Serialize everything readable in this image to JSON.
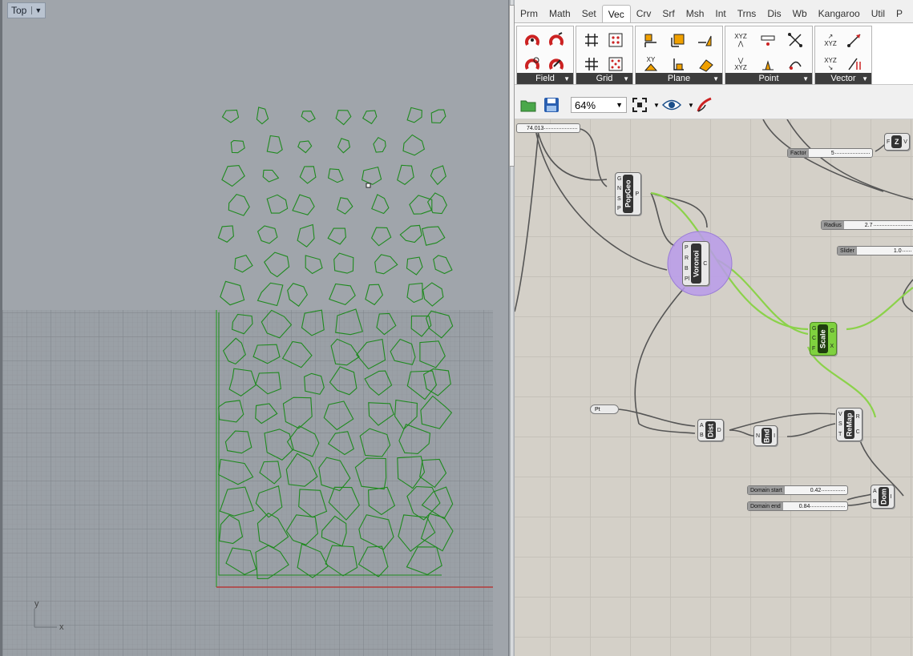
{
  "viewport": {
    "name": "Top",
    "axis_x": "x",
    "axis_y": "y"
  },
  "grasshopper": {
    "tabs": [
      "Prm",
      "Math",
      "Set",
      "Vec",
      "Crv",
      "Srf",
      "Msh",
      "Int",
      "Trns",
      "Dis",
      "Wb",
      "Kangaroo",
      "Util",
      "P"
    ],
    "active_tab": "Vec",
    "ribbon_groups": [
      {
        "label": "Field"
      },
      {
        "label": "Grid"
      },
      {
        "label": "Plane"
      },
      {
        "label": "Point"
      },
      {
        "label": "Vector"
      }
    ],
    "point_icon_text": "XYZ",
    "plane_icon_text": "XY",
    "zoom": "64%",
    "components": {
      "popgeo": {
        "name": "PopGeo",
        "inputs": [
          "G",
          "N",
          "S",
          "P"
        ],
        "outputs": [
          "P"
        ]
      },
      "voronoi": {
        "name": "Voronoi",
        "inputs": [
          "P",
          "R",
          "B",
          "Pl"
        ],
        "outputs": [
          "C"
        ]
      },
      "scale": {
        "name": "Scale",
        "inputs": [
          "G",
          "C",
          "F"
        ],
        "outputs": [
          "G",
          "X"
        ]
      },
      "dist": {
        "name": "Dist",
        "inputs": [
          "A",
          "B"
        ],
        "outputs": [
          "D"
        ]
      },
      "bnd": {
        "name": "Bnd",
        "inputs": [
          "N"
        ],
        "outputs": [
          "I"
        ]
      },
      "remap": {
        "name": "ReMap",
        "inputs": [
          "V",
          "S",
          "T"
        ],
        "outputs": [
          "R",
          "C"
        ]
      },
      "dom": {
        "name": "Dom",
        "inputs": [
          "A",
          "B"
        ],
        "outputs": [
          "I"
        ]
      },
      "z": {
        "name": "Z",
        "inputs": [
          "F"
        ],
        "outputs": [
          "V"
        ]
      }
    },
    "sliders": {
      "top_number": "74.013",
      "factor": {
        "name": "Factor",
        "value": "5"
      },
      "radius": {
        "name": "Radius",
        "value": "2.7"
      },
      "slider": {
        "name": "Slider",
        "value": "1.0"
      },
      "domain_start": {
        "name": "Domain start",
        "value": "0.42"
      },
      "domain_end": {
        "name": "Domain end",
        "value": "0.84"
      }
    },
    "pt_param": "Pt"
  }
}
